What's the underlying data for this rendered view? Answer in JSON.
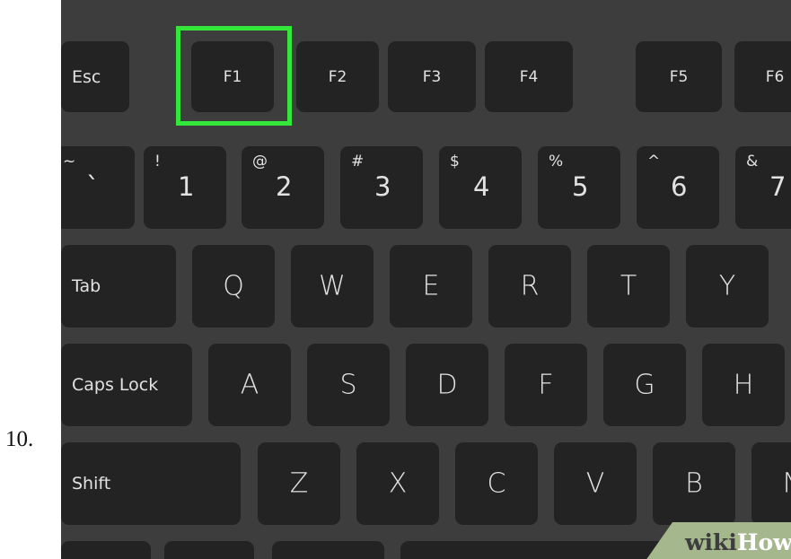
{
  "step_number": "10.",
  "keyboard": {
    "function_row": [
      "Esc",
      "F1",
      "F2",
      "F3",
      "F4",
      "F5",
      "F6"
    ],
    "number_row": [
      {
        "top": "~",
        "main": "`"
      },
      {
        "top": "!",
        "main": "1"
      },
      {
        "top": "@",
        "main": "2"
      },
      {
        "top": "#",
        "main": "3"
      },
      {
        "top": "$",
        "main": "4"
      },
      {
        "top": "%",
        "main": "5"
      },
      {
        "top": "^",
        "main": "6"
      },
      {
        "top": "&",
        "main": "7"
      }
    ],
    "qwerty_row": [
      "Tab",
      "Q",
      "W",
      "E",
      "R",
      "T",
      "Y"
    ],
    "home_row": [
      "Caps Lock",
      "A",
      "S",
      "D",
      "F",
      "G",
      "H"
    ],
    "shift_row": [
      "Shift",
      "Z",
      "X",
      "C",
      "V",
      "B",
      "N"
    ],
    "highlighted_key": "F1",
    "highlight_color": "#33e63a"
  },
  "watermark": {
    "part1": "wiki",
    "part2": "How"
  }
}
